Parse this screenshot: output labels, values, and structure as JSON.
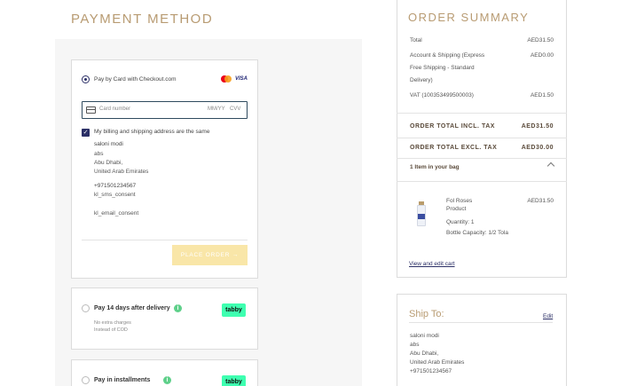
{
  "payment": {
    "title": "PAYMENT METHOD",
    "card_option_label": "Pay by Card with Checkout.com",
    "card_brands": [
      "mastercard",
      "VISA"
    ],
    "card_number_placeholder": "Card number",
    "expiry_placeholder": "MM/YY",
    "cvv_placeholder": "CVV",
    "same_address_label": "My billing and shipping address are the same",
    "billing_name": "saloni modi",
    "billing_line1": "abs",
    "billing_city": "Abu Dhabi,",
    "billing_country": "United Arab Emirates",
    "billing_phone": "+971501234567",
    "sms_consent": "kl_sms_consent",
    "email_consent": "kl_email_consent",
    "place_order_label": "PLACE ORDER",
    "tabby_option_label": "Pay 14 days after delivery",
    "tabby_sub1": "No extra charges",
    "tabby_sub2": "Instead of COD",
    "tabby_brand": "tabby",
    "installments_label": "Pay in installments",
    "info_icon_glyph": "i"
  },
  "summary": {
    "title": "ORDER SUMMARY",
    "total_label": "Total",
    "total_value": "AED31.50",
    "shipping_label_1": "Account & Shipping (Express",
    "shipping_label_2": "Free Shipping - Standard",
    "shipping_label_3": "Delivery)",
    "shipping_value": "AED0.00",
    "vat_label": "VAT (100353499500003)",
    "vat_value": "AED1.50",
    "incl_label": "ORDER TOTAL INCL. TAX",
    "incl_value": "AED31.50",
    "excl_label": "ORDER TOTAL EXCL. TAX",
    "excl_value": "AED30.00",
    "bag_label": "1 Item in your bag",
    "item_name_1": "Fol Roses",
    "item_name_2": "Product",
    "item_price": "AED31.50",
    "item_qty": "Quantity: 1",
    "item_capacity": "Bottle Capacity: 1/2 Tola",
    "view_edit_cart": "View and edit cart"
  },
  "ship": {
    "title": "Ship To:",
    "edit": "Edit",
    "name": "saloni modi",
    "line1": "abs",
    "city": "Abu Dhabi,",
    "country": "United Arab Emirates",
    "phone": "+971501234567"
  },
  "colors": {
    "accent_gold": "#b89b72",
    "navy": "#2b2f66",
    "place_order_bg": "#f9e6a8",
    "tabby_green": "#3effb0"
  }
}
